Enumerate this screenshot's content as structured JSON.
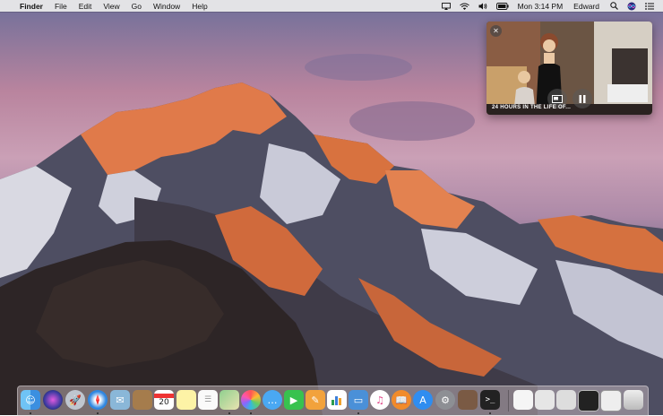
{
  "menubar": {
    "app_name": "Finder",
    "menus": [
      "File",
      "Edit",
      "View",
      "Go",
      "Window",
      "Help"
    ],
    "clock": "Mon 3:14 PM",
    "user": "Edward",
    "status_icons": [
      "airplay-icon",
      "wifi-icon",
      "volume-icon",
      "battery-icon",
      "search-icon",
      "siri-icon",
      "notification-center-icon"
    ]
  },
  "pip": {
    "caption": "24 HOURS IN THE LIFE OF..."
  },
  "dock": {
    "calendar_day": "20",
    "apps": [
      "finder",
      "siri",
      "launchpad",
      "safari",
      "mail-photo",
      "notes-book",
      "calendar",
      "notes",
      "reminders",
      "maps",
      "photos",
      "messages",
      "facetime",
      "ibooks-pages",
      "numbers",
      "keynote",
      "itunes",
      "ibooks",
      "app-store",
      "system-preferences",
      "terminal"
    ],
    "stacks": [
      "documents-stack",
      "downloads-stack",
      "screenshot-1",
      "screenshot-2",
      "screenshot-3",
      "trash"
    ]
  }
}
